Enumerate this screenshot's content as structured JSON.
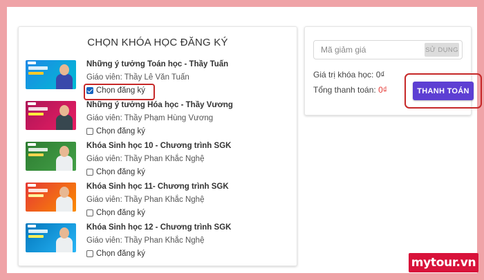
{
  "section_title": "CHỌN KHÓA HỌC ĐĂNG KÝ",
  "courses": [
    {
      "name": "Những ý tưởng Toán học - Thầy Tuấn",
      "teacher": "Giáo viên: Thầy Lê Văn Tuấn",
      "register_label": "Chọn đăng ký",
      "checked": true
    },
    {
      "name": "Những ý tưởng Hóa học - Thầy Vương",
      "teacher": "Giáo viên: Thầy Phạm Hùng Vương",
      "register_label": "Chọn đăng ký",
      "checked": false
    },
    {
      "name": "Khóa Sinh học 10 - Chương trình SGK",
      "teacher": "Giáo viên: Thầy Phan Khắc Nghệ",
      "register_label": "Chọn đăng ký",
      "checked": false
    },
    {
      "name": "Khóa Sinh học 11- Chương trình SGK",
      "teacher": "Giáo viên: Thầy Phan Khắc Nghệ",
      "register_label": "Chọn đăng ký",
      "checked": false
    },
    {
      "name": "Khóa Sinh học 12 - Chương trình SGK",
      "teacher": "Giáo viên: Thầy Phan Khắc Nghệ",
      "register_label": "Chọn đăng ký",
      "checked": false
    }
  ],
  "coupon": {
    "placeholder": "Mã giảm giá",
    "value": "",
    "apply_label": "SỬ DỤNG"
  },
  "summary": {
    "course_value_label": "Giá trị khóa học:",
    "course_value": "0₫",
    "total_label": "Tổng thanh toán:",
    "total_value": "0₫"
  },
  "pay_button_label": "THANH TOÁN",
  "watermark_text": "mytour.vn",
  "colors": {
    "frame": "#efa3a7",
    "pay_button": "#5d3fd3",
    "highlight": "#c62828",
    "total_value": "#e53935",
    "watermark": "#d8123a"
  }
}
